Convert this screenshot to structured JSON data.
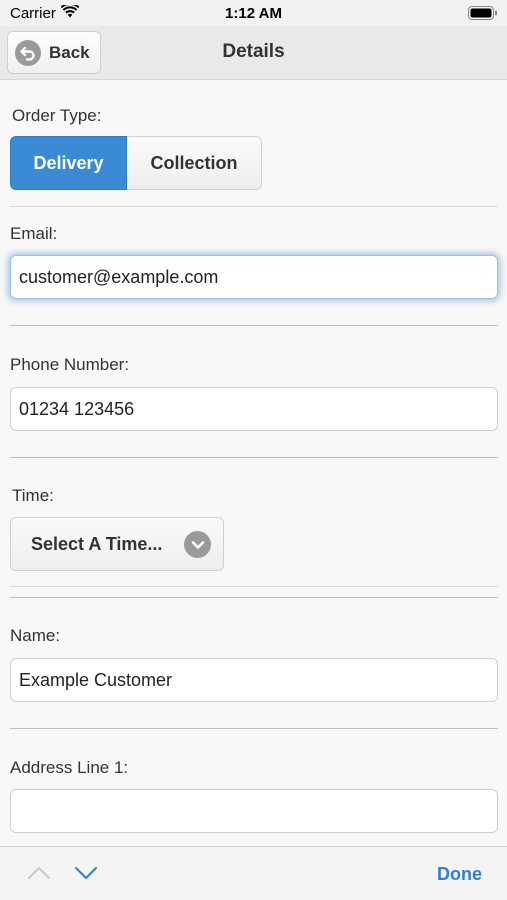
{
  "status_bar": {
    "carrier": "Carrier",
    "time": "1:12 AM"
  },
  "header": {
    "back_label": "Back",
    "title": "Details"
  },
  "form": {
    "order_type_label": "Order Type:",
    "order_type_options": [
      "Delivery",
      "Collection"
    ],
    "order_type_selected": "Delivery",
    "email_label": "Email:",
    "email_value": "customer@example.com",
    "phone_label": "Phone Number:",
    "phone_value": "01234 123456",
    "time_label": "Time:",
    "time_select": "Select A Time...",
    "name_label": "Name:",
    "name_value": "Example Customer",
    "address1_label": "Address Line 1:",
    "address1_value": ""
  },
  "accessory": {
    "done_label": "Done"
  },
  "colors": {
    "accent": "#3b8bd4",
    "link": "#2f7fd6"
  },
  "icons": [
    "wifi-icon",
    "battery-icon",
    "back-arrow-icon",
    "chevron-down-icon",
    "chevron-up-icon"
  ]
}
